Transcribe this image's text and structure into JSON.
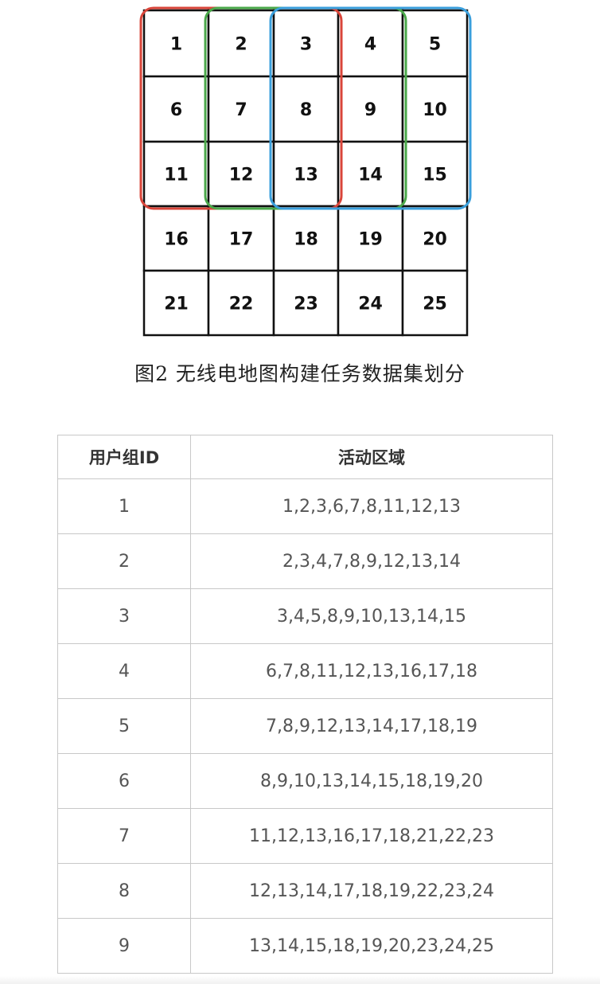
{
  "grid": {
    "rows": [
      [
        "1",
        "2",
        "3",
        "4",
        "5"
      ],
      [
        "6",
        "7",
        "8",
        "9",
        "10"
      ],
      [
        "11",
        "12",
        "13",
        "14",
        "15"
      ],
      [
        "16",
        "17",
        "18",
        "19",
        "20"
      ],
      [
        "21",
        "22",
        "23",
        "24",
        "25"
      ]
    ],
    "highlight_groups": [
      {
        "color": "#d9453a",
        "cells": [
          "1",
          "2",
          "3",
          "6",
          "7",
          "8",
          "11",
          "12",
          "13"
        ]
      },
      {
        "color": "#4aa84a",
        "cells": [
          "2",
          "3",
          "4",
          "7",
          "8",
          "9",
          "12",
          "13",
          "14"
        ]
      },
      {
        "color": "#3a9fdc",
        "cells": [
          "3",
          "4",
          "5",
          "8",
          "9",
          "10",
          "13",
          "14",
          "15"
        ]
      }
    ]
  },
  "caption": "图2 无线电地图构建任务数据集划分",
  "table": {
    "headers": [
      "用户组ID",
      "活动区域"
    ],
    "rows": [
      [
        "1",
        "1,2,3,6,7,8,11,12,13"
      ],
      [
        "2",
        "2,3,4,7,8,9,12,13,14"
      ],
      [
        "3",
        "3,4,5,8,9,10,13,14,15"
      ],
      [
        "4",
        "6,7,8,11,12,13,16,17,18"
      ],
      [
        "5",
        "7,8,9,12,13,14,17,18,19"
      ],
      [
        "6",
        "8,9,10,13,14,15,18,19,20"
      ],
      [
        "7",
        "11,12,13,16,17,18,21,22,23"
      ],
      [
        "8",
        "12,13,14,17,18,19,22,23,24"
      ],
      [
        "9",
        "13,14,15,18,19,20,23,24,25"
      ]
    ]
  }
}
